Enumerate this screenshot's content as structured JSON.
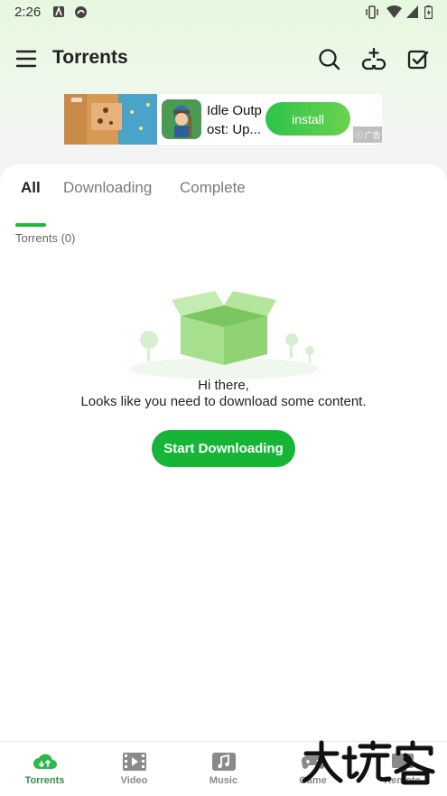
{
  "status_bar": {
    "time": "2:26",
    "icons": [
      "app-notification-icon",
      "app-notification-icon-2",
      "vibrate-icon",
      "wifi-icon",
      "signal-icon",
      "battery-icon"
    ]
  },
  "app_bar": {
    "title": "Torrents",
    "actions": [
      "search-icon",
      "add-link-icon",
      "select-icon"
    ]
  },
  "ad": {
    "app_name": "Idle Outp ost: Up...",
    "install_label": "install",
    "badge": "广告"
  },
  "tabs": [
    {
      "label": "All",
      "active": true
    },
    {
      "label": "Downloading",
      "active": false
    },
    {
      "label": "Complete",
      "active": false
    }
  ],
  "torrent_count": "Torrents (0)",
  "empty_state": {
    "line1": "Hi there,",
    "line2": "Looks like you need to download some content.",
    "button": "Start Downloading"
  },
  "bottom_nav": [
    {
      "label": "Torrents",
      "icon": "cloud-download-icon",
      "active": true
    },
    {
      "label": "Video",
      "icon": "film-icon",
      "active": false
    },
    {
      "label": "Music",
      "icon": "music-icon",
      "active": false
    },
    {
      "label": "Game",
      "icon": "gamepad-icon",
      "active": false
    },
    {
      "label": "Remote",
      "icon": "remote-icon",
      "active": false
    }
  ],
  "colors": {
    "accent": "#16b536",
    "active_tab_indicator": "#1fb839",
    "nav_active": "#3a8c4a"
  }
}
